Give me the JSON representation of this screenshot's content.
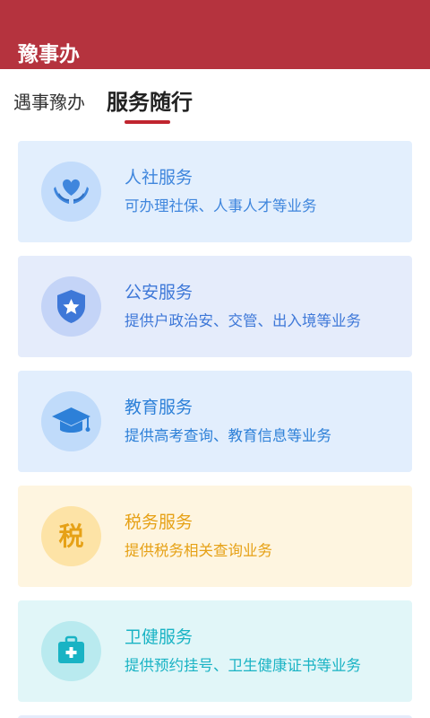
{
  "header": {
    "title": "豫事办"
  },
  "tabs": [
    {
      "label": "遇事豫办",
      "active": false
    },
    {
      "label": "服务随行",
      "active": true
    }
  ],
  "colors": {
    "header": "#b5333e",
    "tab_indicator": "#c0252f"
  },
  "services": [
    {
      "title": "人社服务",
      "desc": "可办理社保、人事人才等业务",
      "icon": "hands-heart-icon",
      "bg": "#e3effd",
      "circle": "#c3dcfb",
      "color": "#3f86dd"
    },
    {
      "title": "公安服务",
      "desc": "提供户政治安、交管、出入境等业务",
      "icon": "police-badge-icon",
      "bg": "#e5ecfb",
      "circle": "#c4d4f7",
      "color": "#3e78d8"
    },
    {
      "title": "教育服务",
      "desc": "提供高考查询、教育信息等业务",
      "icon": "graduation-cap-icon",
      "bg": "#e2eefd",
      "circle": "#c0dbfa",
      "color": "#2d80d8"
    },
    {
      "title": "税务服务",
      "desc": "提供税务相关查询业务",
      "icon": "tax-icon",
      "icon_text": "税",
      "bg": "#fef5e0",
      "circle": "#fde3a6",
      "color": "#e6a116"
    },
    {
      "title": "卫健服务",
      "desc": "提供预约挂号、卫生健康证书等业务",
      "icon": "medical-kit-icon",
      "bg": "#e1f6f8",
      "circle": "#b9eaef",
      "color": "#19b3c4"
    }
  ]
}
